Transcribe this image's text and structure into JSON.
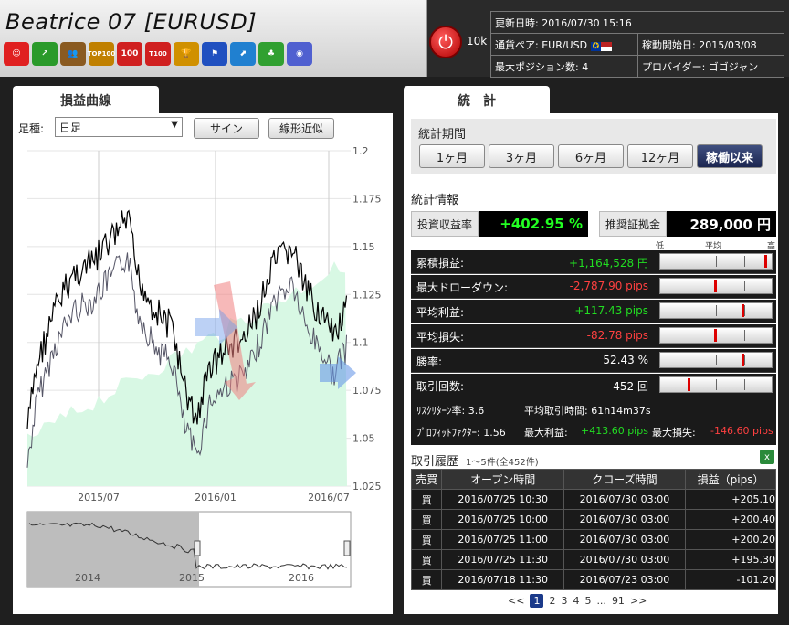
{
  "header": {
    "title": "Beatrice 07 [EURUSD]",
    "power_label": "10k",
    "badges": [
      {
        "icon": "smile-icon",
        "text": "☺",
        "color": "#e02020"
      },
      {
        "icon": "chart-up-icon",
        "text": "↗",
        "color": "#2a9a2a"
      },
      {
        "icon": "people-icon",
        "text": "👥",
        "color": "#8a5a20"
      },
      {
        "icon": "top100-icon",
        "text": "TOP100",
        "color": "#c08000"
      },
      {
        "icon": "rank100-icon",
        "text": "100",
        "color": "#d02020"
      },
      {
        "icon": "t100-icon",
        "text": "T100",
        "color": "#d02020"
      },
      {
        "icon": "trophy-icon",
        "text": "🏆",
        "color": "#d09000"
      },
      {
        "icon": "flag-icon",
        "text": "⚑",
        "color": "#2050c0"
      },
      {
        "icon": "growth-icon",
        "text": "⬈",
        "color": "#2080d0"
      },
      {
        "icon": "clover-icon",
        "text": "♣",
        "color": "#30a030"
      },
      {
        "icon": "globe-icon",
        "text": "◉",
        "color": "#5060d0"
      }
    ],
    "info": {
      "updated_label": "更新日時: 2016/07/30 15:16",
      "pair_label": "通貨ペア: EUR/USD",
      "start_label": "稼動開始日: 2015/03/08",
      "maxpos_label": "最大ポジション数: 4",
      "provider_label": "プロバイダー: ゴゴジャン"
    }
  },
  "left": {
    "tab": "損益曲線",
    "period_label": "足種:",
    "period_value": "日足",
    "sign_button": "サイン",
    "linear_button": "線形近似",
    "y_ticks": [
      "1.2",
      "1.175",
      "1.15",
      "1.125",
      "1.1",
      "1.075",
      "1.05",
      "1.025"
    ],
    "x_ticks": [
      "2015/07",
      "2016/01",
      "2016/07"
    ],
    "nav_x_ticks": [
      "2014",
      "2015",
      "2016"
    ]
  },
  "right": {
    "tab": "統　計",
    "period_title": "統計期間",
    "period_buttons": [
      "1ヶ月",
      "3ヶ月",
      "6ヶ月",
      "12ヶ月",
      "稼働以来"
    ],
    "stats_title": "統計情報",
    "roi_label": "投資収益率",
    "roi_value": "+402.95 %",
    "margin_label": "推奨証拠金",
    "margin_value": "289,000 円",
    "scale_labels": [
      "低",
      "平均",
      "高"
    ],
    "rows": [
      {
        "label": "累積損益:",
        "value": "+1,164,528 円",
        "cls": "pos",
        "mark": 0.97
      },
      {
        "label": "最大ドローダウン:",
        "value": "-2,787.90 pips",
        "cls": "neg",
        "mark": 0.5
      },
      {
        "label": "平均利益:",
        "value": "+117.43 pips",
        "cls": "pos",
        "mark": 0.75
      },
      {
        "label": "平均損失:",
        "value": "-82.78 pips",
        "cls": "neg",
        "mark": 0.5
      },
      {
        "label": "勝率:",
        "value": "52.43 %",
        "cls": "",
        "mark": 0.75
      },
      {
        "label": "取引回数:",
        "value": "452 回",
        "cls": "",
        "mark": 0.25
      }
    ],
    "extra1_a": "ﾘｽｸﾘﾀｰﾝ率: 3.6",
    "extra1_b": "平均取引時間: 61h14m37s",
    "extra2_a": "ﾌﾟﾛﾌｨｯﾄﾌｧｸﾀｰ: 1.56",
    "extra2_b_label": "最大利益:",
    "extra2_b_value": "+413.60 pips",
    "extra2_c_label": "最大損失:",
    "extra2_c_value": "-146.60 pips",
    "history_title": "取引履歴",
    "history_sub": "1〜5件(全452件)",
    "columns": [
      "売買",
      "オープン時間",
      "クローズ時間",
      "損益（pips）"
    ],
    "trades": [
      {
        "side": "買",
        "open": "2016/07/25 10:30",
        "close": "2016/07/30 03:00",
        "pnl": "+205.10",
        "cls": "pos"
      },
      {
        "side": "買",
        "open": "2016/07/25 10:00",
        "close": "2016/07/30 03:00",
        "pnl": "+200.40",
        "cls": "pos"
      },
      {
        "side": "買",
        "open": "2016/07/25 11:00",
        "close": "2016/07/30 03:00",
        "pnl": "+200.20",
        "cls": "pos"
      },
      {
        "side": "買",
        "open": "2016/07/25 11:30",
        "close": "2016/07/30 03:00",
        "pnl": "+195.30",
        "cls": "pos"
      },
      {
        "side": "買",
        "open": "2016/07/18 11:30",
        "close": "2016/07/23 03:00",
        "pnl": "-101.20",
        "cls": "neg"
      }
    ],
    "pager": {
      "prev": "<<",
      "pages": [
        "1",
        "2",
        "3",
        "4",
        "5"
      ],
      "ellipsis": "...",
      "last": "91",
      "next": ">>"
    }
  }
}
